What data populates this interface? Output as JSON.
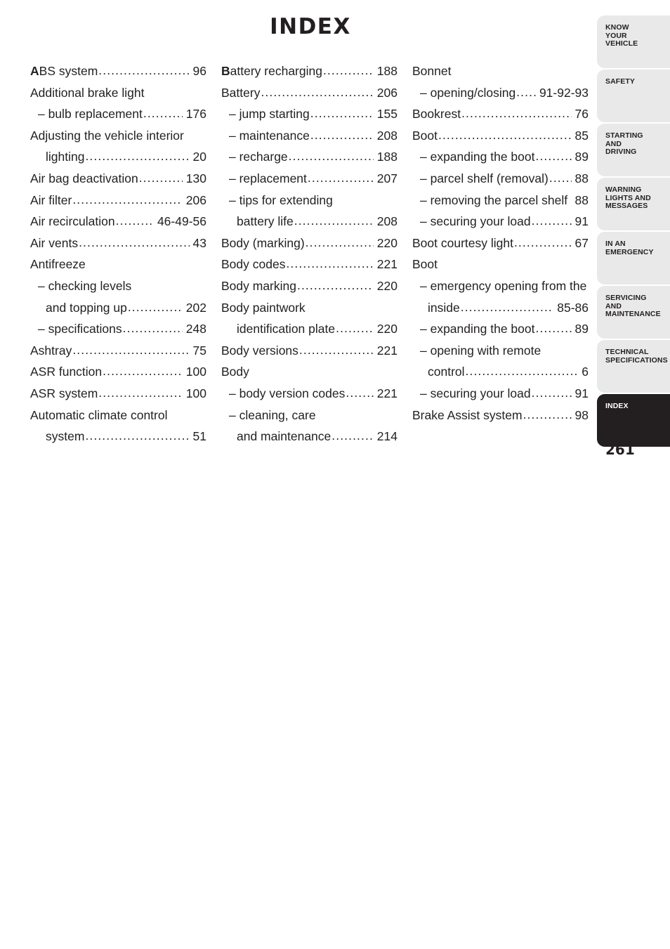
{
  "document": {
    "title": "INDEX",
    "page_number": "261"
  },
  "columns": [
    {
      "name": "column-1",
      "entries": [
        {
          "cap": "A",
          "label": "BS system",
          "dots": true,
          "page": "96",
          "level": 1
        },
        {
          "cap": "",
          "label": "Additional brake light",
          "dots": false,
          "page": "",
          "level": 1
        },
        {
          "cap": "",
          "label": "– bulb replacement",
          "dots": true,
          "page": "176",
          "level": 2
        },
        {
          "cap": "",
          "label": "Adjusting the vehicle interior",
          "dots": false,
          "page": "",
          "level": 1
        },
        {
          "cap": "",
          "label": "lighting",
          "dots": true,
          "page": "20",
          "level": 3
        },
        {
          "cap": "",
          "label": "Air bag deactivation",
          "dots": true,
          "page": "130",
          "level": 1
        },
        {
          "cap": "",
          "label": "Air filter",
          "dots": true,
          "page": "206",
          "level": 1
        },
        {
          "cap": "",
          "label": "Air recirculation",
          "dots": true,
          "page": "46-49-56",
          "level": 1
        },
        {
          "cap": "",
          "label": "Air vents",
          "dots": true,
          "page": "43",
          "level": 1
        },
        {
          "cap": "",
          "label": "Antifreeze",
          "dots": false,
          "page": "",
          "level": 1
        },
        {
          "cap": "",
          "label": "– checking levels",
          "dots": false,
          "page": "",
          "level": 2
        },
        {
          "cap": "",
          "label": "and topping up",
          "dots": true,
          "page": "202",
          "level": 3
        },
        {
          "cap": "",
          "label": "– specifications",
          "dots": true,
          "page": "248",
          "level": 2
        },
        {
          "cap": "",
          "label": "Ashtray",
          "dots": true,
          "page": "75",
          "level": 1
        },
        {
          "cap": "",
          "label": "ASR function",
          "dots": true,
          "page": "100",
          "level": 1
        },
        {
          "cap": "",
          "label": "ASR system",
          "dots": true,
          "page": "100",
          "level": 1
        },
        {
          "cap": "",
          "label": "Automatic climate control",
          "dots": false,
          "page": "",
          "level": 1
        },
        {
          "cap": "",
          "label": "system",
          "dots": true,
          "page": "51",
          "level": 3
        }
      ]
    },
    {
      "name": "column-2",
      "entries": [
        {
          "cap": "B",
          "label": "attery recharging",
          "dots": true,
          "page": "188",
          "level": 1
        },
        {
          "cap": "",
          "label": "Battery",
          "dots": true,
          "page": "206",
          "level": 1
        },
        {
          "cap": "",
          "label": "– jump starting",
          "dots": true,
          "page": "155",
          "level": 2
        },
        {
          "cap": "",
          "label": "– maintenance",
          "dots": true,
          "page": "208",
          "level": 2
        },
        {
          "cap": "",
          "label": "– recharge",
          "dots": true,
          "page": "188",
          "level": 2
        },
        {
          "cap": "",
          "label": "– replacement",
          "dots": true,
          "page": "207",
          "level": 2
        },
        {
          "cap": "",
          "label": "– tips for extending",
          "dots": false,
          "page": "",
          "level": 2
        },
        {
          "cap": "",
          "label": "battery life",
          "dots": true,
          "page": "208",
          "level": 3
        },
        {
          "cap": "",
          "label": "Body (marking)",
          "dots": true,
          "page": "220",
          "level": 1
        },
        {
          "cap": "",
          "label": "Body codes",
          "dots": true,
          "page": "221",
          "level": 1
        },
        {
          "cap": "",
          "label": "Body marking",
          "dots": true,
          "page": "220",
          "level": 1
        },
        {
          "cap": "",
          "label": "Body paintwork",
          "dots": false,
          "page": "",
          "level": 1
        },
        {
          "cap": "",
          "label": "identification plate",
          "dots": true,
          "page": "220",
          "level": 3
        },
        {
          "cap": "",
          "label": "Body versions",
          "dots": true,
          "page": "221",
          "level": 1
        },
        {
          "cap": "",
          "label": "Body",
          "dots": false,
          "page": "",
          "level": 1
        },
        {
          "cap": "",
          "label": "– body version codes",
          "dots": true,
          "page": "221",
          "level": 2
        },
        {
          "cap": "",
          "label": "– cleaning, care",
          "dots": false,
          "page": "",
          "level": 2
        },
        {
          "cap": "",
          "label": "and maintenance",
          "dots": true,
          "page": "214",
          "level": 3
        }
      ]
    },
    {
      "name": "column-3",
      "entries": [
        {
          "cap": "",
          "label": "Bonnet",
          "dots": false,
          "page": "",
          "level": 1
        },
        {
          "cap": "",
          "label": "– opening/closing",
          "dots": true,
          "page": "91-92-93",
          "level": 2
        },
        {
          "cap": "",
          "label": "Bookrest",
          "dots": true,
          "page": "76",
          "level": 1
        },
        {
          "cap": "",
          "label": "Boot",
          "dots": true,
          "page": "85",
          "level": 1
        },
        {
          "cap": "",
          "label": "– expanding the boot",
          "dots": true,
          "page": "89",
          "level": 2
        },
        {
          "cap": "",
          "label": "– parcel shelf (removal)",
          "dots": true,
          "page": "88",
          "level": 2
        },
        {
          "cap": "",
          "label": "– removing the parcel shelf",
          "dots": false,
          "page": "88",
          "level": 2
        },
        {
          "cap": "",
          "label": "– securing your load",
          "dots": true,
          "page": "91",
          "level": 2
        },
        {
          "cap": "",
          "label": "Boot courtesy light",
          "dots": true,
          "page": "67",
          "level": 1
        },
        {
          "cap": "",
          "label": "Boot",
          "dots": false,
          "page": "",
          "level": 1
        },
        {
          "cap": "",
          "label": "– emergency opening from the",
          "dots": false,
          "page": "",
          "level": 2
        },
        {
          "cap": "",
          "label": "inside",
          "dots": true,
          "page": "85-86",
          "level": 3
        },
        {
          "cap": "",
          "label": "– expanding the boot",
          "dots": true,
          "page": "89",
          "level": 2
        },
        {
          "cap": "",
          "label": "– opening with remote",
          "dots": false,
          "page": "",
          "level": 2
        },
        {
          "cap": "",
          "label": "control",
          "dots": true,
          "page": "6",
          "level": 3
        },
        {
          "cap": "",
          "label": "– securing your load",
          "dots": true,
          "page": "91",
          "level": 2
        },
        {
          "cap": "",
          "label": "Brake Assist system",
          "dots": true,
          "page": "98",
          "level": 1
        }
      ]
    }
  ],
  "tab_rail": {
    "tabs": [
      {
        "name": "know-your-vehicle",
        "lines": [
          "KNOW",
          "YOUR",
          "VEHICLE"
        ],
        "active": false
      },
      {
        "name": "safety",
        "lines": [
          "SAFETY"
        ],
        "active": false
      },
      {
        "name": "starting-and-driving",
        "lines": [
          "STARTING",
          "AND",
          "DRIVING"
        ],
        "active": false
      },
      {
        "name": "warning-lights-and-messages",
        "lines": [
          "WARNING",
          "LIGHTS AND",
          "MESSAGES"
        ],
        "active": false
      },
      {
        "name": "in-an-emergency",
        "lines": [
          "IN AN",
          "EMERGENCY"
        ],
        "active": false
      },
      {
        "name": "servicing-and-maintenance",
        "lines": [
          "SERVICING",
          "AND",
          "MAINTENANCE"
        ],
        "active": false
      },
      {
        "name": "technical-specifications",
        "lines": [
          "TECHNICAL",
          "SPECIFICATIONS"
        ],
        "active": false
      },
      {
        "name": "index",
        "lines": [
          "INDEX"
        ],
        "active": true
      }
    ]
  },
  "colors": {
    "ink": "#231f20",
    "tab_background": "#e9e9e9",
    "tab_active_background": "#231f20",
    "tab_active_text": "#ffffff",
    "page_background": "#ffffff"
  }
}
